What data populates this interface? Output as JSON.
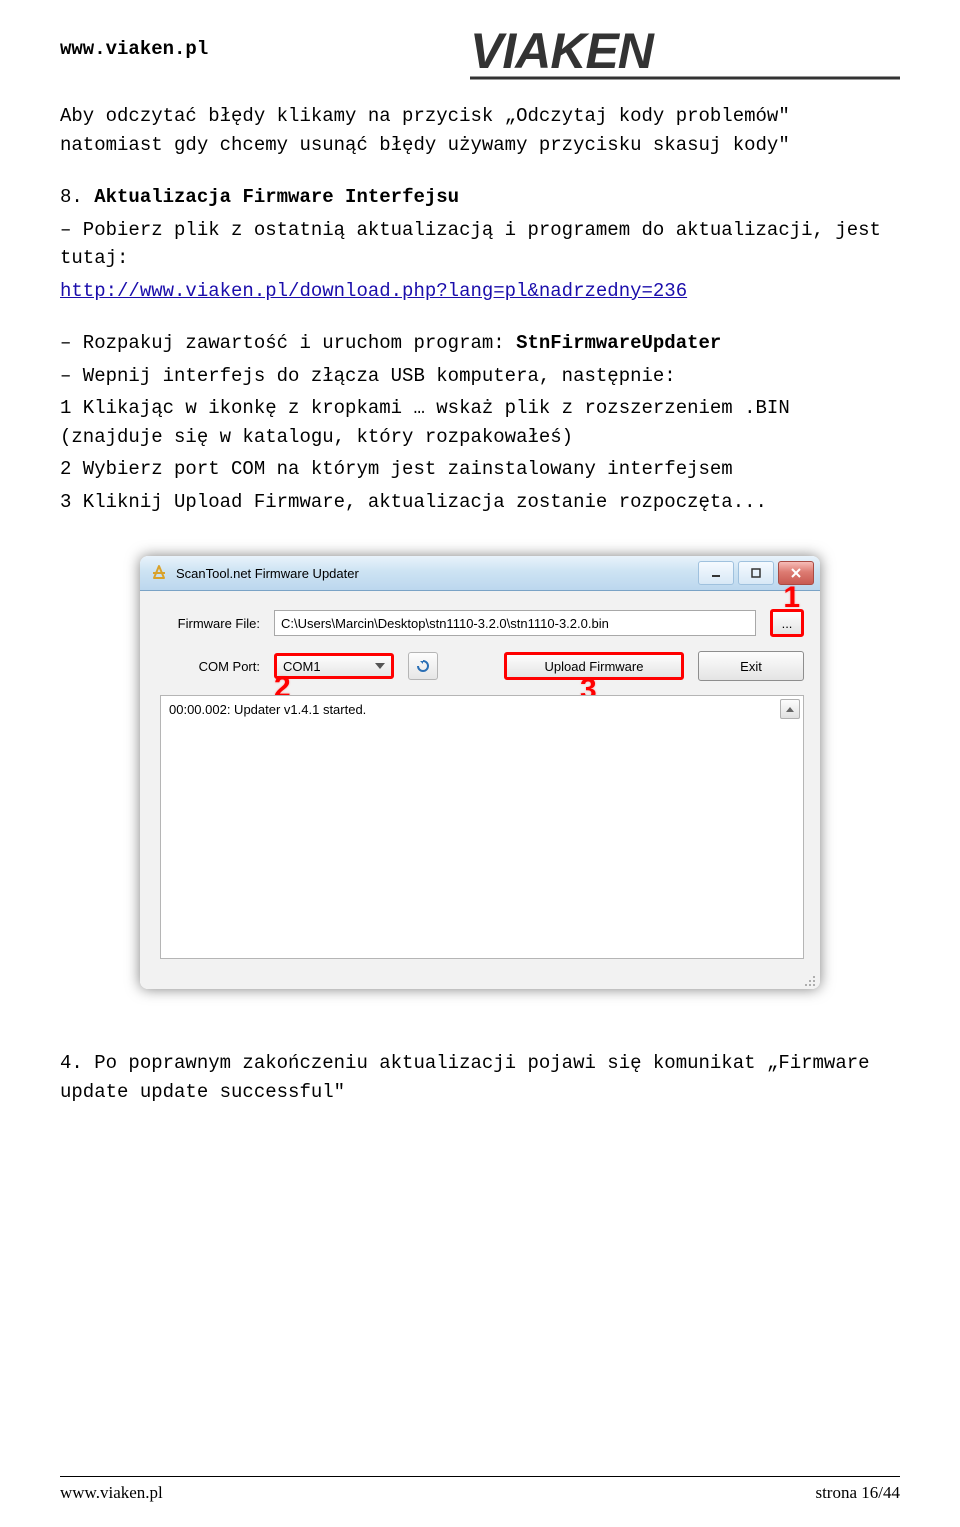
{
  "header": {
    "url": "www.viaken.pl",
    "logo_text": "VIAKEN"
  },
  "doc": {
    "p1": "Aby odczytać błędy klikamy na przycisk „Odczytaj kody problemów\" natomiast gdy chcemy usunąć  błędy używamy przycisku skasuj kody\"",
    "h8_num": "8.",
    "h8_title": "Aktualizacja Firmware Interfejsu",
    "p2": "– Pobierz plik z ostatnią aktualizacją i programem do aktualizacji, jest tutaj:",
    "link": "http://www.viaken.pl/download.php?lang=pl&nadrzedny=236",
    "p3a": "– Rozpakuj zawartość i uruchom program: ",
    "p3b": "StnFirmwareUpdater",
    "p4": "– Wepnij interfejs do złącza USB komputera, następnie:",
    "p5": "1 Klikając w ikonkę z kropkami … wskaż plik z rozszerzeniem .BIN (znajduje się w katalogu, który rozpakowałeś)",
    "p6": "2 Wybierz port COM na którym jest zainstalowany interfejsem",
    "p7": "3 Kliknij Upload Firmware, aktualizacja zostanie rozpoczęta...",
    "p_after": "4. Po poprawnym zakończeniu aktualizacji pojawi się komunikat „Firmware update update successful\""
  },
  "app": {
    "title": "ScanTool.net Firmware Updater",
    "labels": {
      "firmware_file": "Firmware File:",
      "com_port": "COM Port:"
    },
    "values": {
      "firmware_file": "C:\\Users\\Marcin\\Desktop\\stn1110-3.2.0\\stn1110-3.2.0.bin",
      "com_port": "COM1"
    },
    "buttons": {
      "browse": "...",
      "upload": "Upload Firmware",
      "exit": "Exit"
    },
    "log": "00:00.002: Updater v1.4.1 started.",
    "window_buttons": {
      "min": "–",
      "max": "□",
      "close": "X"
    },
    "callouts": {
      "one": "1",
      "two": "2",
      "three": "3"
    }
  },
  "footer": {
    "left": "www.viaken.pl",
    "right": "strona 16/44"
  }
}
